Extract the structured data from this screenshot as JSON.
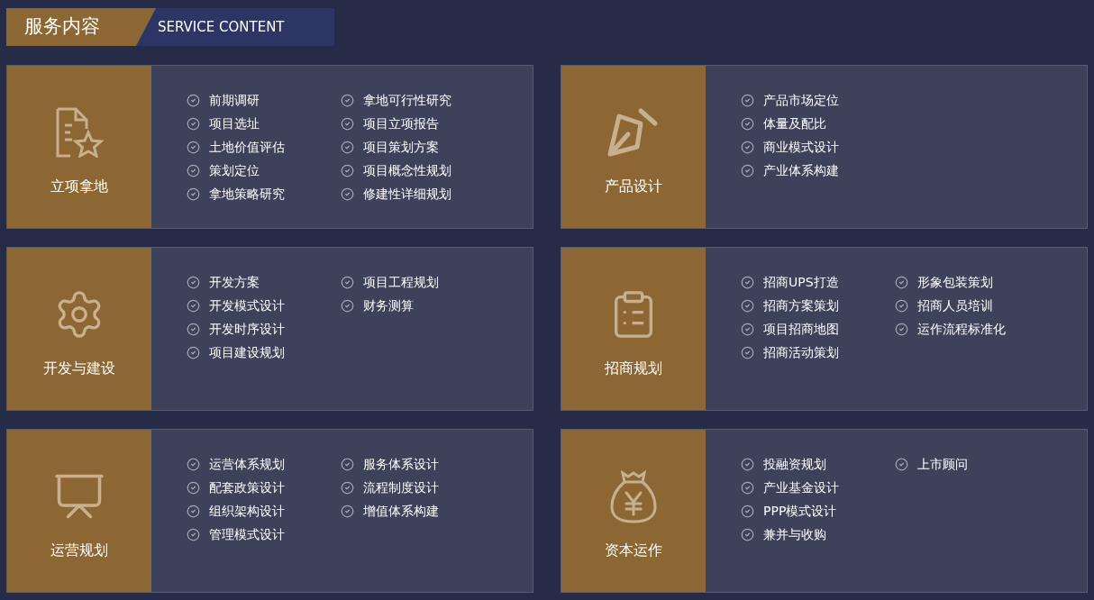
{
  "header": {
    "title": "服务内容",
    "subtitle": "SERVICE CONTENT"
  },
  "cards": [
    {
      "kind": "document-star",
      "title": "立项拿地",
      "columns": [
        [
          "前期调研",
          "项目选址",
          "土地价值评估",
          "策划定位",
          "拿地策略研究"
        ],
        [
          "拿地可行性研究",
          "项目立项报告",
          "项目策划方案",
          "项目概念性规划",
          "修建性详细规划"
        ]
      ]
    },
    {
      "kind": "pen",
      "title": "产品设计",
      "columns": [
        [
          "产品市场定位",
          "体量及配比",
          "商业模式设计",
          "产业体系构建"
        ]
      ]
    },
    {
      "kind": "gear",
      "title": "开发与建设",
      "columns": [
        [
          "开发方案",
          "开发模式设计",
          "开发时序设计",
          "项目建设规划"
        ],
        [
          "项目工程规划",
          "财务测算"
        ]
      ]
    },
    {
      "kind": "clipboard",
      "title": "招商规划",
      "columns": [
        [
          "招商UPS打造",
          "招商方案策划",
          "项目招商地图",
          "招商活动策划"
        ],
        [
          "形象包装策划",
          "招商人员培训",
          "运作流程标准化"
        ]
      ]
    },
    {
      "kind": "presentation",
      "title": "运营规划",
      "columns": [
        [
          "运营体系规划",
          "配套政策设计",
          "组织架构设计",
          "管理模式设计"
        ],
        [
          "服务体系设计",
          "流程制度设计",
          "增值体系构建"
        ]
      ]
    },
    {
      "kind": "moneybag",
      "title": "资本运作",
      "columns": [
        [
          "投融资规划",
          "产业基金设计",
          "PPP模式设计",
          "兼并与收购"
        ],
        [
          "上市顾问"
        ]
      ]
    }
  ]
}
